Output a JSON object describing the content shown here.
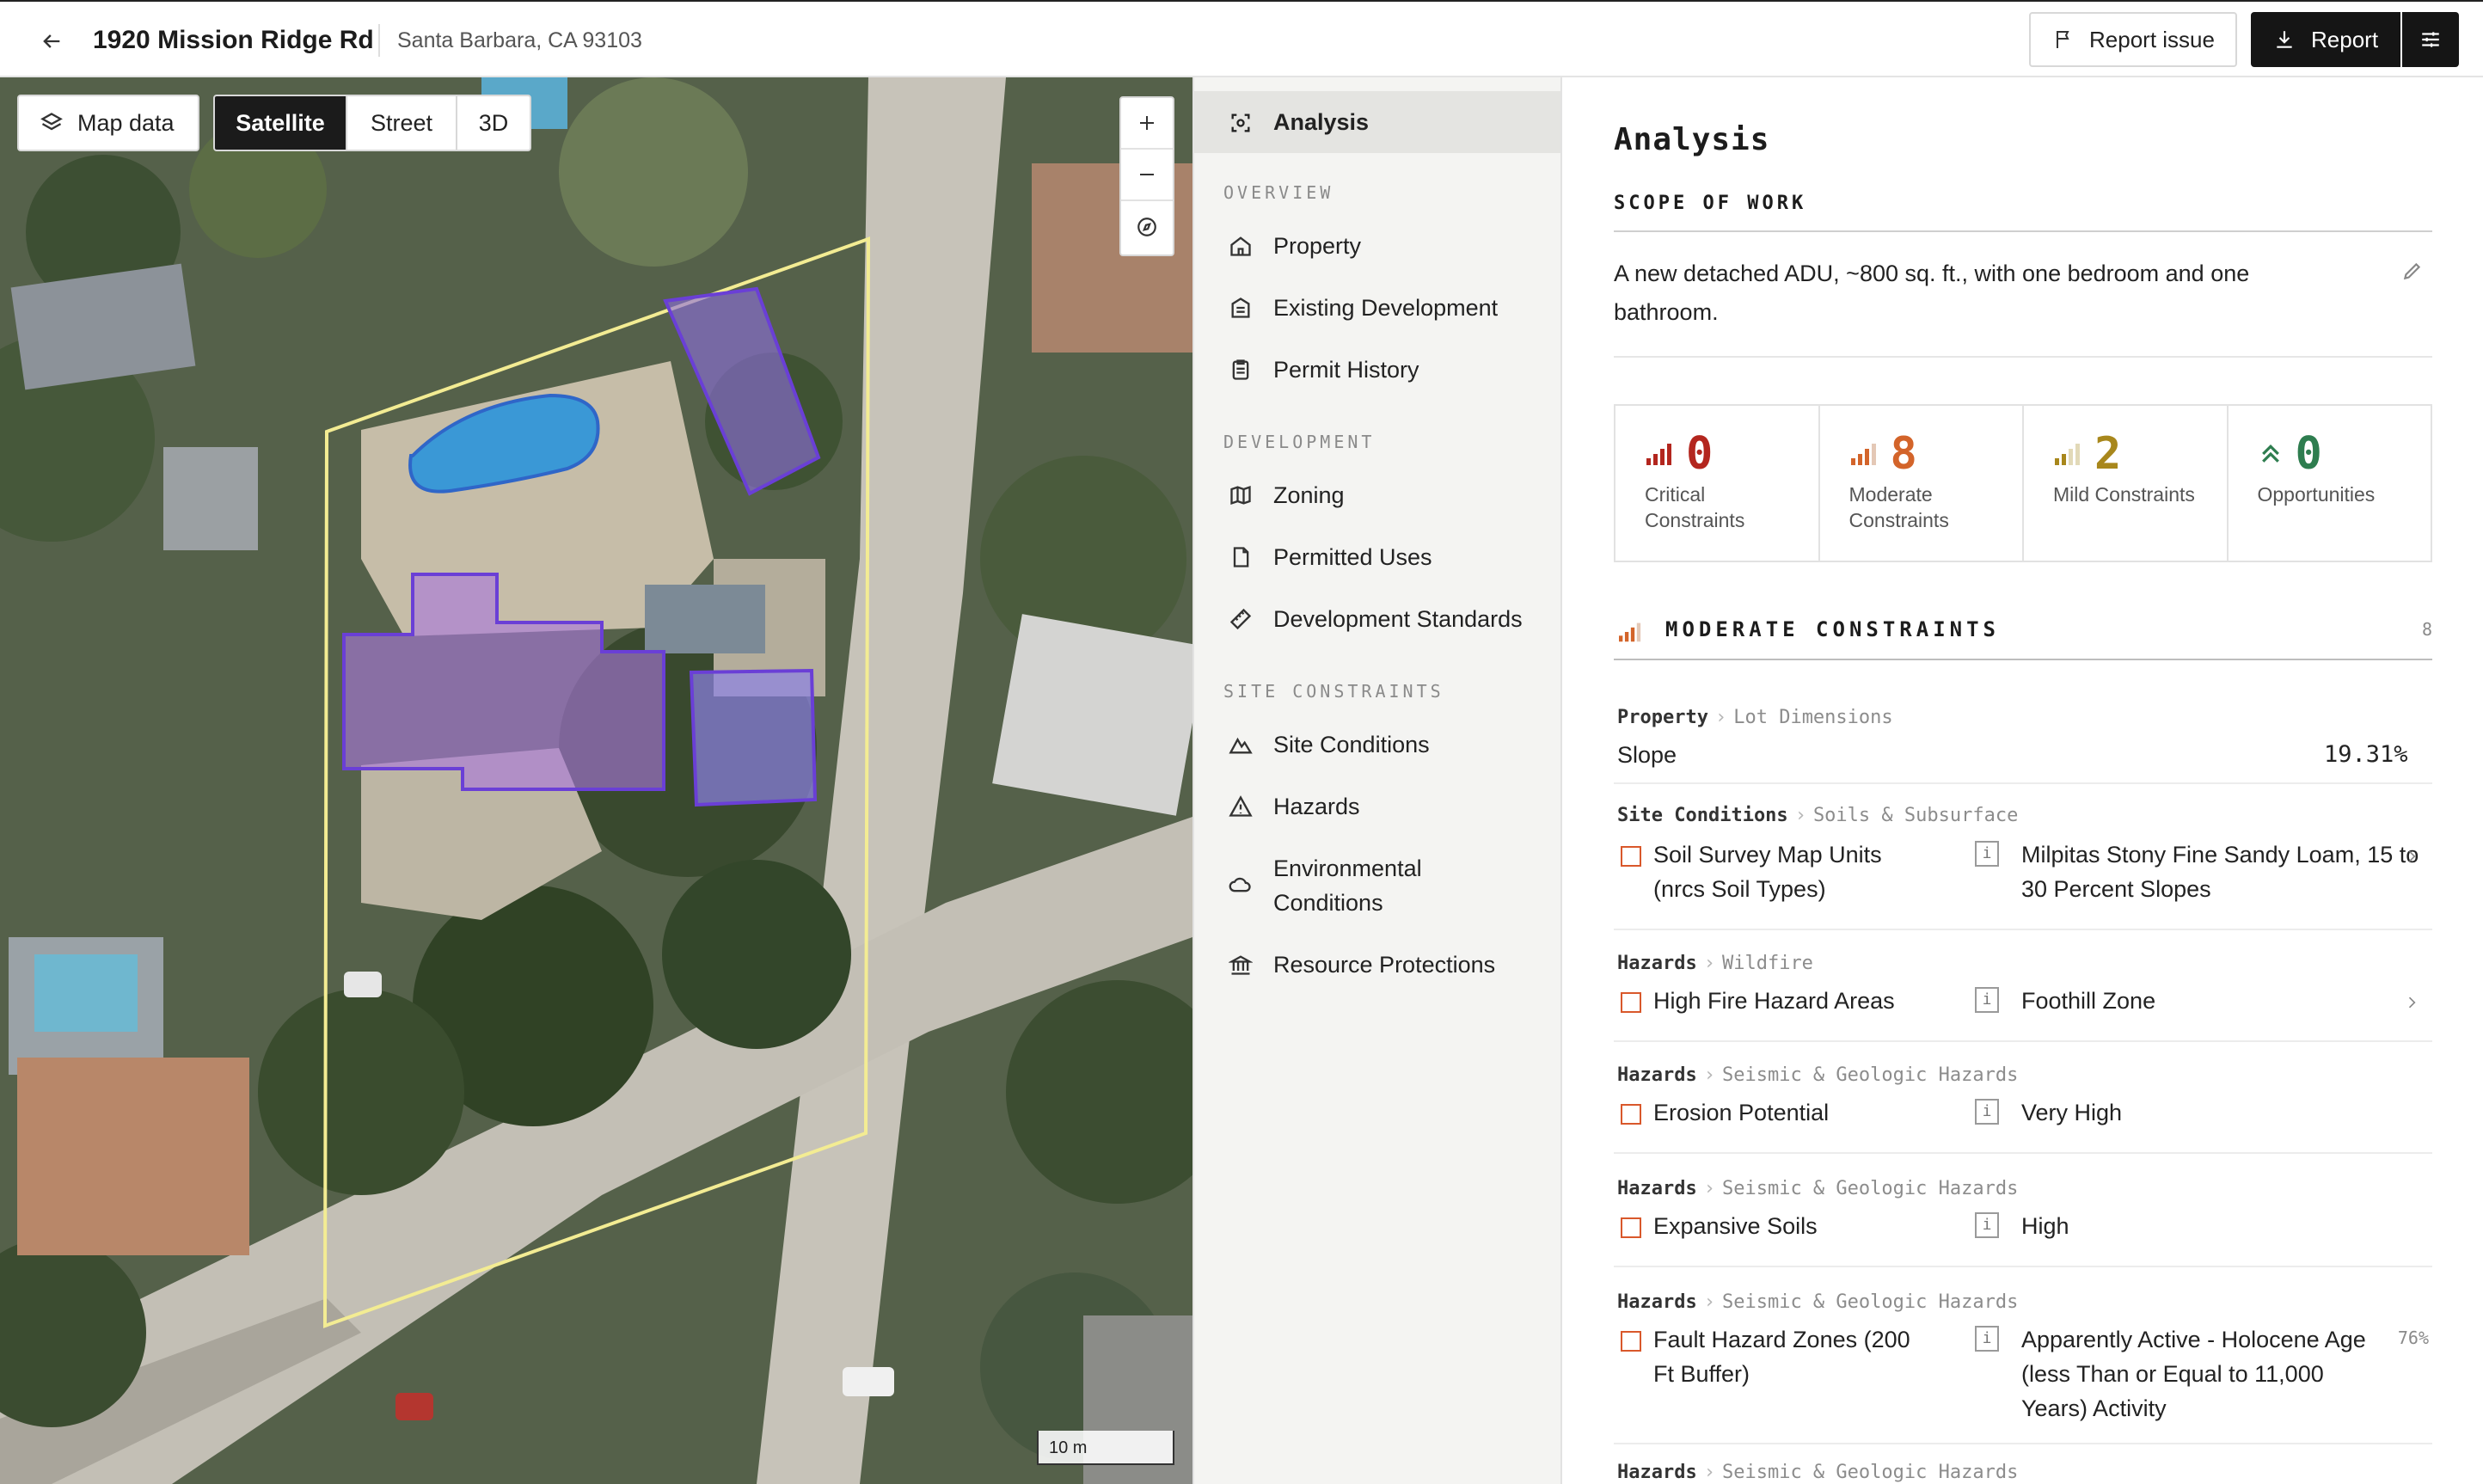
{
  "header": {
    "address": "1920 Mission Ridge Rd",
    "city": "Santa Barbara, CA 93103",
    "report_issue_label": "Report issue",
    "report_label": "Report"
  },
  "map": {
    "map_data_label": "Map data",
    "views": [
      "Satellite",
      "Street",
      "3D"
    ],
    "active_view": "Satellite",
    "scale_label": "10 m"
  },
  "nav": {
    "active": {
      "label": "Analysis",
      "icon": "scan-icon"
    },
    "sections": [
      {
        "title": "OVERVIEW",
        "items": [
          {
            "label": "Property",
            "icon": "home-icon"
          },
          {
            "label": "Existing Development",
            "icon": "building-icon"
          },
          {
            "label": "Permit History",
            "icon": "clipboard-icon"
          }
        ]
      },
      {
        "title": "DEVELOPMENT",
        "items": [
          {
            "label": "Zoning",
            "icon": "map-icon"
          },
          {
            "label": "Permitted Uses",
            "icon": "document-icon"
          },
          {
            "label": "Development Standards",
            "icon": "ruler-icon"
          }
        ]
      },
      {
        "title": "SITE CONSTRAINTS",
        "items": [
          {
            "label": "Site Conditions",
            "icon": "mountain-icon"
          },
          {
            "label": "Hazards",
            "icon": "warning-icon"
          },
          {
            "label": "Environmental Conditions",
            "icon": "cloud-icon"
          },
          {
            "label": "Resource Protections",
            "icon": "landmark-icon"
          }
        ]
      }
    ]
  },
  "content": {
    "title": "Analysis",
    "scope_label": "SCOPE OF WORK",
    "scope_text": "A new detached ADU, ~800 sq. ft., with one bedroom and one bathroom.",
    "stats": [
      {
        "value": "0",
        "label": "Critical Constraints",
        "color": "#b3261e",
        "icon": "signal-4-icon"
      },
      {
        "value": "8",
        "label": "Moderate Constraints",
        "color": "#d3642a",
        "icon": "signal-3-icon"
      },
      {
        "value": "2",
        "label": "Mild Constraints",
        "color": "#a8871c",
        "icon": "signal-2-icon"
      },
      {
        "value": "0",
        "label": "Opportunities",
        "color": "#2e7d4f",
        "icon": "chevrons-up-icon"
      }
    ],
    "moderate": {
      "title": "MODERATE CONSTRAINTS",
      "count": "8",
      "rows": [
        {
          "category": "Property",
          "subcategory": "Lot Dimensions",
          "label": "Slope",
          "value": "19.31%",
          "kind": "metric"
        },
        {
          "category": "Site Conditions",
          "subcategory": "Soils & Subsurface",
          "label": "Soil Survey Map Units (nrcs Soil Types)",
          "value": "Milpitas Stony Fine Sandy Loam, 15 to 30 Percent Slopes",
          "chevron": true
        },
        {
          "category": "Hazards",
          "subcategory": "Wildfire",
          "label": "High Fire Hazard Areas",
          "value": "Foothill Zone",
          "chevron": true
        },
        {
          "category": "Hazards",
          "subcategory": "Seismic & Geologic Hazards",
          "label": "Erosion Potential",
          "value": "Very High"
        },
        {
          "category": "Hazards",
          "subcategory": "Seismic & Geologic Hazards",
          "label": "Expansive Soils",
          "value": "High"
        },
        {
          "category": "Hazards",
          "subcategory": "Seismic & Geologic Hazards",
          "label": "Fault Hazard Zones (200 Ft Buffer)",
          "value": "Apparently Active - Holocene Age (less Than or Equal to 11,000 Years) Activity",
          "pct": "76%"
        },
        {
          "category": "Hazards",
          "subcategory": "Seismic & Geologic Hazards"
        }
      ]
    },
    "info_glyph": "i",
    "colors": {
      "constraint": "#d9582b",
      "accent_dark": "#151515"
    }
  }
}
